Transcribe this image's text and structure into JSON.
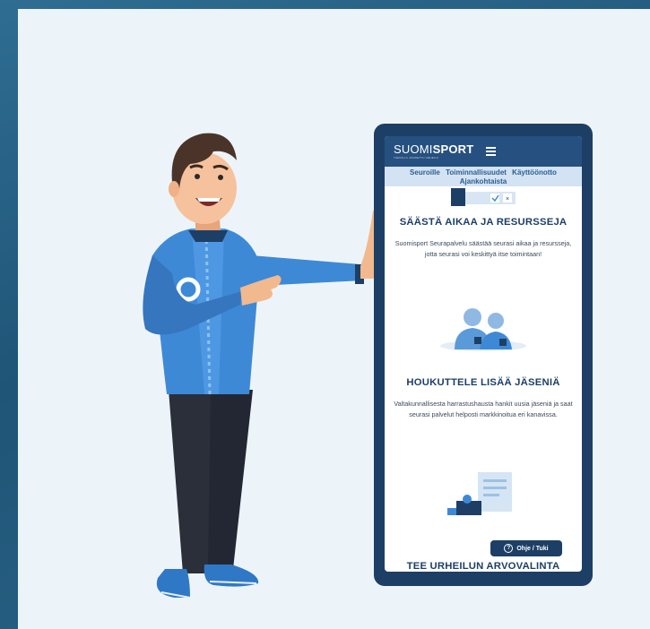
{
  "app": {
    "logo_prefix": "SUOMI",
    "logo_bold": "SPORT",
    "logo_tagline": "TIEDOLLA JOHDETTU URHEILU"
  },
  "nav": {
    "items": [
      "Seuroille",
      "Toiminnallisuudet",
      "Käyttöönotto",
      "Ajankohtaista"
    ]
  },
  "features": [
    {
      "heading": "SÄÄSTÄ AIKAA JA RESURSSEJA",
      "text": "Suomisport Seurapalvelu säästää seurasi aikaa ja resursseja, jotta seurasi voi keskittyä itse toimintaan!"
    },
    {
      "heading": "HOUKUTTELE LISÄÄ JÄSENIÄ",
      "text": "Valtakunnallisesta harrastushausta hankit uusia jäseniä ja saat seurasi palvelut helposti markkinoitua eri kanavissa."
    },
    {
      "heading": "TEE URHEILUN ARVOVALINTA"
    }
  ],
  "help_button": {
    "label": "Ohje / Tuki",
    "icon": "question-circle-icon"
  },
  "colors": {
    "navy": "#1d3f66",
    "header": "#26507f",
    "nav_bg": "#d3e3f3",
    "card_bg": "#edf4f9",
    "accent_blue": "#3e89d6"
  }
}
